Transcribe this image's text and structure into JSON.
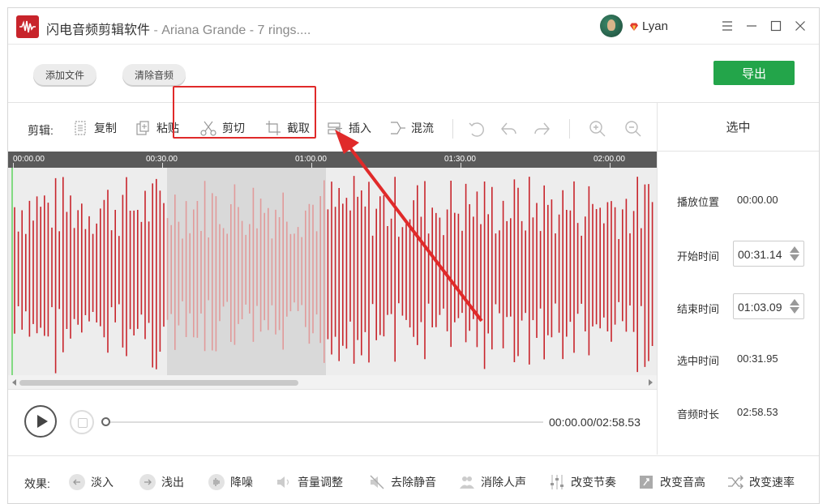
{
  "titlebar": {
    "app_name": "闪电音频剪辑软件",
    "separator": " - ",
    "file_name": "Ariana Grande - 7 rings....",
    "username": "Lyan",
    "controls": [
      "menu-icon",
      "minimize-icon",
      "maximize-icon",
      "close-icon"
    ]
  },
  "topbar": {
    "add_file": "添加文件",
    "clear_audio": "清除音频",
    "export": "导出"
  },
  "editbar": {
    "label": "剪辑:",
    "copy": "复制",
    "paste": "粘贴",
    "cut": "剪切",
    "trim": "截取",
    "insert": "插入",
    "mix": "混流",
    "icons": [
      "rotate-icon",
      "undo-icon",
      "redo-icon",
      "zoom-in-icon",
      "zoom-out-icon"
    ]
  },
  "timeline": {
    "ticks": [
      "00:00.00",
      "00:30.00",
      "01:00.00",
      "01:30.00",
      "02:00.00"
    ]
  },
  "right_panel": {
    "header": "选中",
    "play_position_label": "播放位置",
    "play_position": "00:00.00",
    "start_time_label": "开始时间",
    "start_time": "00:31.14",
    "end_time_label": "结束时间",
    "end_time": "01:03.09",
    "selected_time_label": "选中时间",
    "selected_time": "00:31.95",
    "duration_label": "音频时长",
    "duration": "02:58.53"
  },
  "player": {
    "time_readout": "00:00.00/02:58.53",
    "progress": 0
  },
  "effects": {
    "label": "效果:",
    "items": [
      "淡入",
      "浅出",
      "降噪",
      "音量调整",
      "去除静音",
      "消除人声",
      "改变节奏",
      "改变音高",
      "改变速率"
    ]
  },
  "colors": {
    "accent_green": "#23a54a",
    "wave_red": "#c8242b",
    "wave_selected": "#e19a9a",
    "highlight_red": "#e02a2a"
  }
}
